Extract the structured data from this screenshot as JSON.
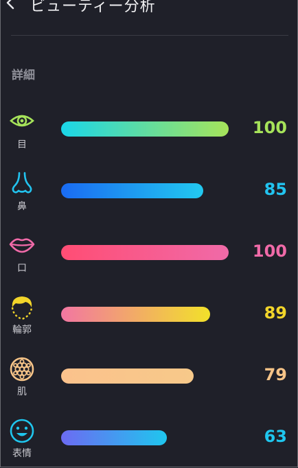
{
  "header": {
    "title": "ビューティー分析",
    "back_icon": "chevron-left-icon"
  },
  "section": {
    "label": "詳細"
  },
  "items": [
    {
      "label": "目",
      "icon": "eye-icon",
      "score": 100,
      "score_text": "100",
      "level": 1.0,
      "color": "#a6e35a",
      "gradient": [
        "#1ad6e8",
        "#a6e35a"
      ]
    },
    {
      "label": "鼻",
      "icon": "nose-icon",
      "score": 85,
      "score_text": "85",
      "level": 0.85,
      "color": "#22c3ef",
      "gradient": [
        "#1a6bf2",
        "#22c9f0"
      ]
    },
    {
      "label": "口",
      "icon": "lips-icon",
      "score": 100,
      "score_text": "100",
      "level": 1.0,
      "color": "#f06aa8",
      "gradient": [
        "#ff4d74",
        "#f06aa8"
      ]
    },
    {
      "label": "輪郭",
      "icon": "face-contour-icon",
      "score": 89,
      "score_text": "89",
      "level": 0.89,
      "color": "#f2d52a",
      "gradient": [
        "#f276a2",
        "#f2e12a"
      ]
    },
    {
      "label": "肌",
      "icon": "skin-texture-icon",
      "score": 79,
      "score_text": "79",
      "level": 0.79,
      "color": "#f6c488",
      "gradient": [
        "#fbc28c",
        "#f7c98a"
      ]
    },
    {
      "label": "表情",
      "icon": "smile-icon",
      "score": 63,
      "score_text": "63",
      "level": 0.63,
      "color": "#1fc6ee",
      "gradient": [
        "#6c6bf2",
        "#1fc6ee"
      ]
    }
  ]
}
